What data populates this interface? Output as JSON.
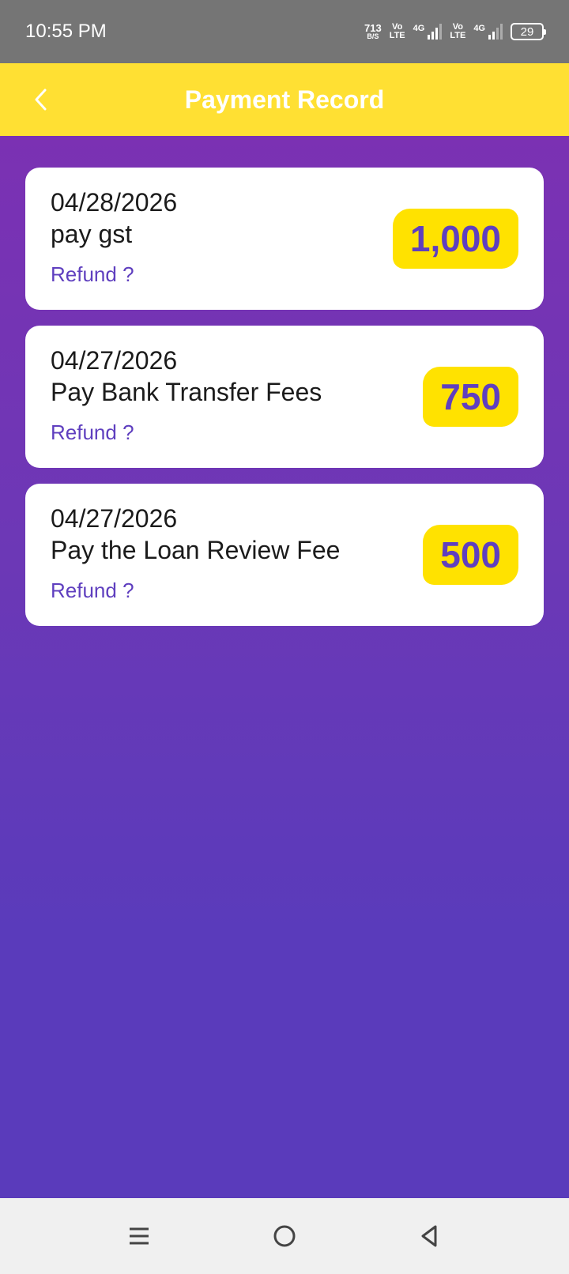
{
  "status_bar": {
    "time": "10:55 PM",
    "net_speed_value": "713",
    "net_speed_unit": "B/S",
    "sim1_top": "Vo",
    "sim1_bottom": "LTE",
    "sim1_net": "4G",
    "sim2_top": "Vo",
    "sim2_bottom": "LTE",
    "sim2_net": "4G",
    "battery": "29"
  },
  "header": {
    "title": "Payment Record",
    "back_icon": "chevron-left-icon",
    "background": "#ffe033"
  },
  "records": [
    {
      "date": "04/28/2026",
      "description": "pay gst",
      "refund_label": "Refund ?",
      "amount": "1,000"
    },
    {
      "date": "04/27/2026",
      "description": "Pay Bank Transfer Fees",
      "refund_label": "Refund ?",
      "amount": "750"
    },
    {
      "date": "04/27/2026",
      "description": "Pay the Loan Review Fee",
      "refund_label": "Refund ?",
      "amount": "500"
    }
  ],
  "nav_bar": {
    "menu_icon": "menu-icon",
    "home_icon": "home-circle-icon",
    "back_icon": "triangle-back-icon"
  },
  "colors": {
    "accent_yellow": "#ffe200",
    "accent_purple": "#5f3fbf",
    "gradient_top": "#7b31b3",
    "gradient_bottom": "#5a3bbb"
  }
}
